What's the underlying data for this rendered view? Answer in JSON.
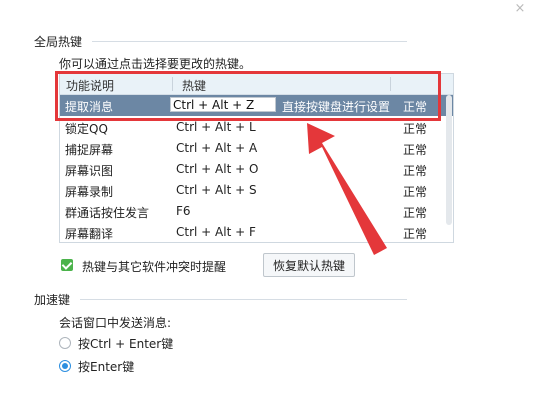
{
  "window": {
    "close_glyph": "×"
  },
  "global_hotkeys": {
    "title": "全局热键",
    "hint": "你可以通过点击选择要更改的热键。",
    "columns": {
      "function": "功能说明",
      "hotkey": "热键"
    },
    "rows": [
      {
        "function": "提取消息",
        "hotkey": "Ctrl + Alt + Z",
        "note": "直接按键盘进行设置",
        "status": "正常",
        "selected": true
      },
      {
        "function": "锁定QQ",
        "hotkey": "Ctrl + Alt + L",
        "status": "正常"
      },
      {
        "function": "捕捉屏幕",
        "hotkey": "Ctrl + Alt + A",
        "status": "正常"
      },
      {
        "function": "屏幕识图",
        "hotkey": "Ctrl + Alt + O",
        "status": "正常"
      },
      {
        "function": "屏幕录制",
        "hotkey": "Ctrl + Alt + S",
        "status": "正常"
      },
      {
        "function": "群通话按住发言",
        "hotkey": "F6",
        "status": "正常"
      },
      {
        "function": "屏幕翻译",
        "hotkey": "Ctrl + Alt + F",
        "status": "正常"
      }
    ],
    "conflict_checkbox_label": "热键与其它软件冲突时提醒",
    "conflict_checked": true,
    "restore_button": "恢复默认热键"
  },
  "shortcut_keys": {
    "title": "加速键",
    "send_label": "会话窗口中发送消息:",
    "options": [
      {
        "label": "按Ctrl + Enter键",
        "checked": false
      },
      {
        "label": "按Enter键",
        "checked": true
      }
    ]
  },
  "colors": {
    "annotation_red": "#e4373a",
    "selected_row": "#6c87a4",
    "checkbox_green": "#4bb34b",
    "radio_blue": "#2d8fe0"
  }
}
